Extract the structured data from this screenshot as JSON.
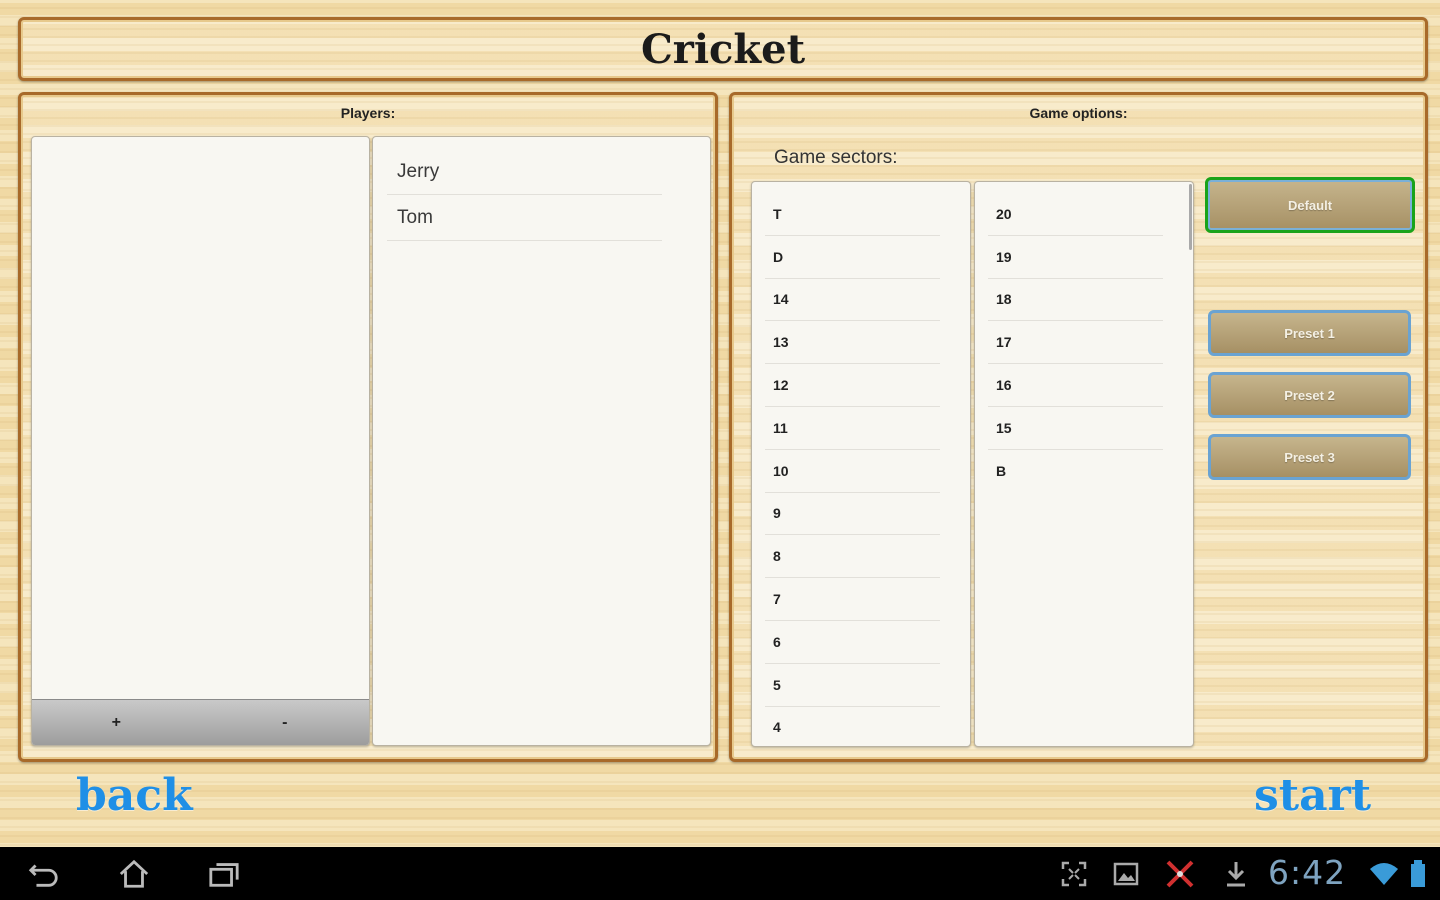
{
  "title": "Cricket",
  "players_panel": {
    "heading": "Players:",
    "selected_players": [],
    "add_label": "+",
    "remove_label": "-",
    "available_players": [
      "Jerry",
      "Tom"
    ]
  },
  "options_panel": {
    "heading": "Game options:",
    "sectors_label": "Game sectors:",
    "sectors_left": [
      "T",
      "D",
      "14",
      "13",
      "12",
      "11",
      "10",
      "9",
      "8",
      "7",
      "6",
      "5",
      "4"
    ],
    "sectors_right": [
      "20",
      "19",
      "18",
      "17",
      "16",
      "15",
      "B"
    ],
    "buttons": {
      "default": "Default",
      "preset1": "Preset 1",
      "preset2": "Preset 2",
      "preset3": "Preset 3"
    }
  },
  "navigation": {
    "back": "back",
    "start": "start"
  },
  "status_bar": {
    "time": "6:42",
    "icons": [
      "back-icon",
      "home-icon",
      "recent-apps-icon",
      "screen-compat-icon",
      "gallery-notification-icon",
      "darts-notification-icon",
      "download-icon",
      "wifi-icon",
      "battery-icon"
    ]
  },
  "colors": {
    "link": "#1f8fe6",
    "default_highlight": "#1aa31a",
    "preset_border": "#6aa3d2",
    "frame": "#a86a2a"
  }
}
